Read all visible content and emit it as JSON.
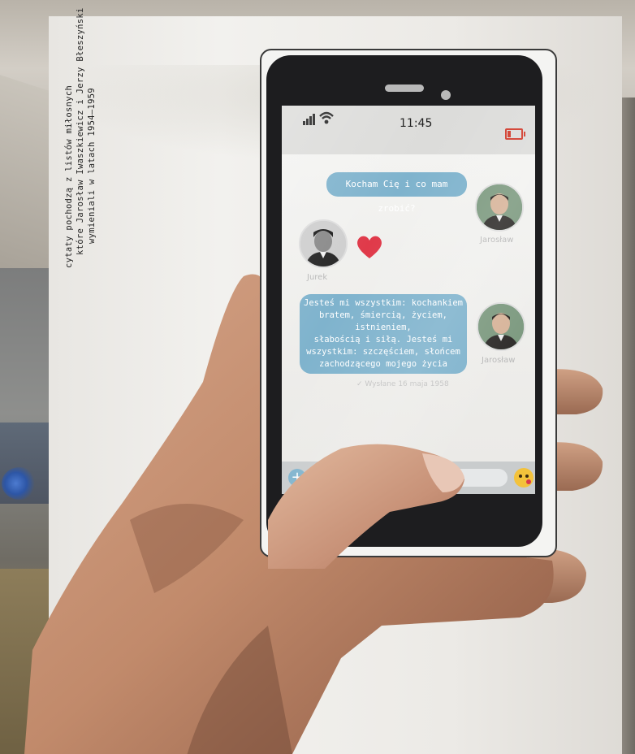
{
  "caption": {
    "line1": "cytaty pochodzą z listów miłosnych",
    "line2": "które Jarosław Iwaszkiewicz i Jerzy Błeszyński",
    "line3": "wymieniali w latach 1954–1959"
  },
  "phone": {
    "status": {
      "time": "11:45"
    },
    "messages": [
      {
        "from": "Jarosław",
        "text": "Kocham Cię i co mam zrobić?"
      },
      {
        "from": "Jurek",
        "text": "heart"
      },
      {
        "from": "Jarosław",
        "lines": [
          "Jesteś mi wszystkim: kochankiem",
          "bratem, śmiercią, życiem, istnieniem,",
          "słabością i siłą. Jesteś mi",
          "wszystkim: szczęściem, słońcem",
          "zachodzącego mojego życia"
        ]
      }
    ],
    "contacts": {
      "left": "Jurek",
      "right": "Jarosław"
    },
    "sent_note": "✓ Wysłane 16 maja 1958",
    "input": {
      "plus": "+",
      "emoji": "kiss-emoji"
    }
  },
  "colors": {
    "bubble": "#7fb3cd",
    "heart": "#e03a4a",
    "battery": "#d13a2b"
  }
}
